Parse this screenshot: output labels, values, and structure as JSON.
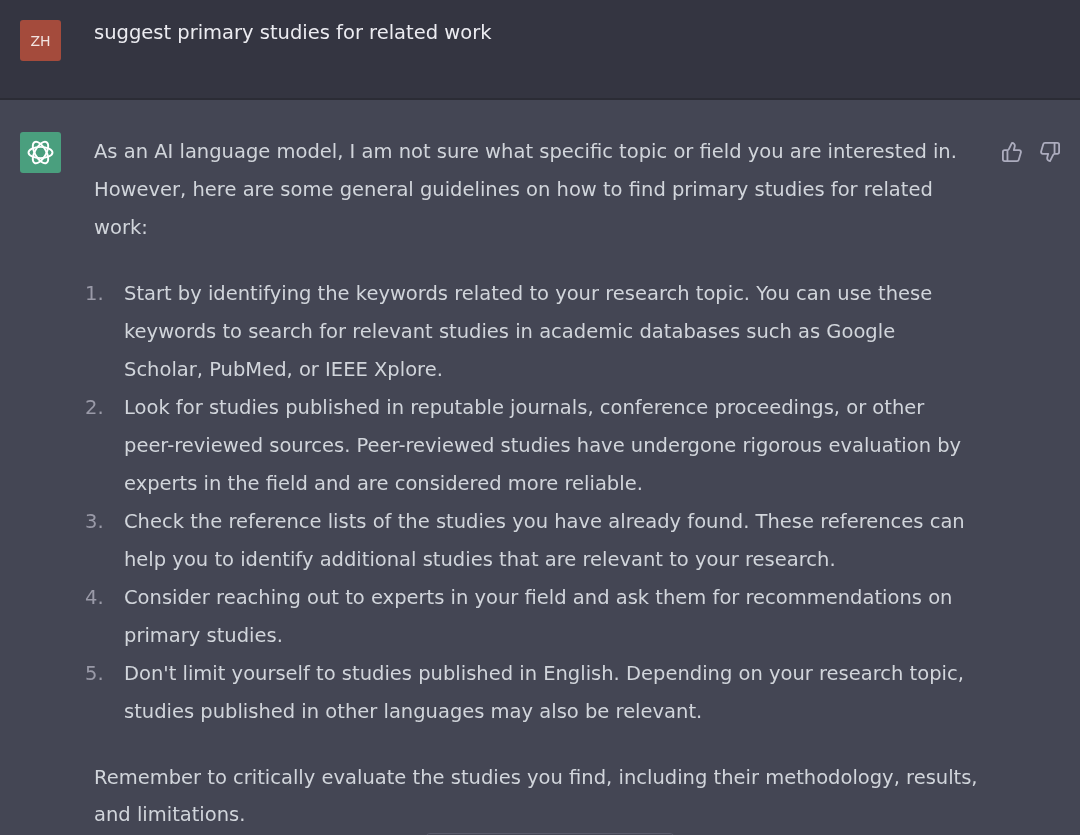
{
  "user_message": {
    "avatar_initials": "ZH",
    "text": "suggest primary studies for related work"
  },
  "assistant_message": {
    "intro": "As an AI language model, I am not sure what specific topic or field you are interested in. However, here are some general guidelines on how to find primary studies for related work:",
    "steps": [
      {
        "number": "1.",
        "text": "Start by identifying the keywords related to your research topic. You can use these keywords to search for relevant studies in academic databases such as Google Scholar, PubMed, or IEEE Xplore."
      },
      {
        "number": "2.",
        "text": "Look for studies published in reputable journals, conference proceedings, or other peer-reviewed sources. Peer-reviewed studies have undergone rigorous evaluation by experts in the field and are considered more reliable."
      },
      {
        "number": "3.",
        "text": "Check the reference lists of the studies you have already found. These references can help you to identify additional studies that are relevant to your research."
      },
      {
        "number": "4.",
        "text": "Consider reaching out to experts in your field and ask them for recommendations on primary studies."
      },
      {
        "number": "5.",
        "text": "Don't limit yourself to studies published in English. Depending on your research topic, studies published in other languages may also be relevant."
      }
    ],
    "closing": "Remember to critically evaluate the studies you find, including their methodology, results, and limitations."
  }
}
